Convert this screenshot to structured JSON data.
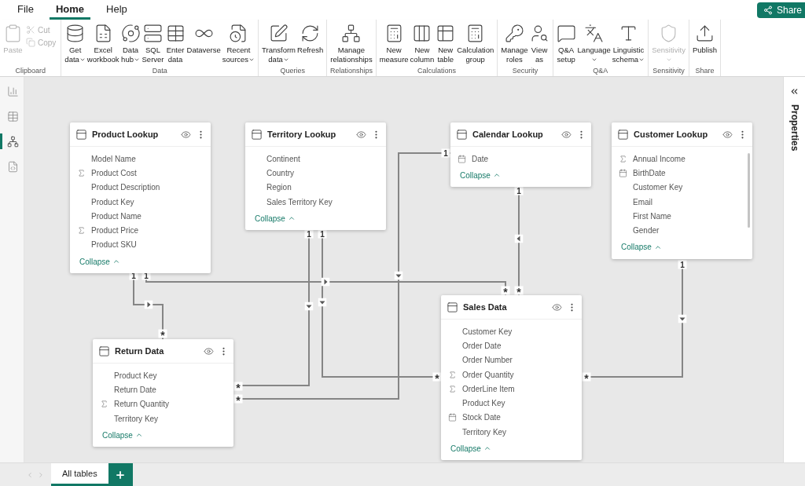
{
  "menu": {
    "tabs": [
      {
        "label": "File",
        "selected": false
      },
      {
        "label": "Home",
        "selected": true
      },
      {
        "label": "Help",
        "selected": false
      }
    ]
  },
  "share_button": {
    "label": "Share"
  },
  "ribbon": {
    "groups": [
      {
        "label": "Clipboard",
        "buttons": [
          {
            "lines": [
              "Paste"
            ],
            "kind": "large",
            "disabled": true,
            "dropdown": false
          },
          {
            "lines": [
              "Cut"
            ],
            "kind": "small",
            "disabled": true,
            "dropdown": false
          },
          {
            "lines": [
              "Copy"
            ],
            "kind": "small",
            "disabled": true,
            "dropdown": false
          }
        ]
      },
      {
        "label": "Data",
        "buttons": [
          {
            "lines": [
              "Get",
              "data"
            ],
            "kind": "large",
            "disabled": false,
            "dropdown": true
          },
          {
            "lines": [
              "Excel",
              "workbook"
            ],
            "kind": "large",
            "disabled": false,
            "dropdown": false
          },
          {
            "lines": [
              "Data",
              "hub"
            ],
            "kind": "large",
            "disabled": false,
            "dropdown": true
          },
          {
            "lines": [
              "SQL",
              "Server"
            ],
            "kind": "large",
            "disabled": false,
            "dropdown": false
          },
          {
            "lines": [
              "Enter",
              "data"
            ],
            "kind": "large",
            "disabled": false,
            "dropdown": false
          },
          {
            "lines": [
              "Dataverse"
            ],
            "kind": "large",
            "disabled": false,
            "dropdown": false
          },
          {
            "lines": [
              "Recent",
              "sources"
            ],
            "kind": "large",
            "disabled": false,
            "dropdown": true
          }
        ]
      },
      {
        "label": "Queries",
        "buttons": [
          {
            "lines": [
              "Transform",
              "data"
            ],
            "kind": "large",
            "disabled": false,
            "dropdown": true
          },
          {
            "lines": [
              "Refresh"
            ],
            "kind": "large",
            "disabled": false,
            "dropdown": false
          }
        ]
      },
      {
        "label": "Relationships",
        "buttons": [
          {
            "lines": [
              "Manage",
              "relationships"
            ],
            "kind": "large",
            "disabled": false,
            "dropdown": false
          }
        ]
      },
      {
        "label": "Calculations",
        "buttons": [
          {
            "lines": [
              "New",
              "measure"
            ],
            "kind": "large",
            "disabled": false,
            "dropdown": false
          },
          {
            "lines": [
              "New",
              "column"
            ],
            "kind": "large",
            "disabled": false,
            "dropdown": false
          },
          {
            "lines": [
              "New",
              "table"
            ],
            "kind": "large",
            "disabled": false,
            "dropdown": false
          },
          {
            "lines": [
              "Calculation",
              "group"
            ],
            "kind": "large",
            "disabled": false,
            "dropdown": false
          }
        ]
      },
      {
        "label": "Security",
        "buttons": [
          {
            "lines": [
              "Manage",
              "roles"
            ],
            "kind": "large",
            "disabled": false,
            "dropdown": false
          },
          {
            "lines": [
              "View",
              "as"
            ],
            "kind": "large",
            "disabled": false,
            "dropdown": false
          }
        ]
      },
      {
        "label": "Q&A",
        "buttons": [
          {
            "lines": [
              "Q&A",
              "setup"
            ],
            "kind": "large",
            "disabled": false,
            "dropdown": false
          },
          {
            "lines": [
              "Language"
            ],
            "kind": "large",
            "disabled": false,
            "dropdown": true
          },
          {
            "lines": [
              "Linguistic",
              "schema"
            ],
            "kind": "large",
            "disabled": false,
            "dropdown": true
          }
        ]
      },
      {
        "label": "Sensitivity",
        "buttons": [
          {
            "lines": [
              "Sensitivity"
            ],
            "kind": "large",
            "disabled": true,
            "dropdown": true
          }
        ]
      },
      {
        "label": "Share",
        "buttons": [
          {
            "lines": [
              "Publish"
            ],
            "kind": "large",
            "disabled": false,
            "dropdown": false
          }
        ]
      }
    ]
  },
  "view_rail": [
    {
      "selected": false
    },
    {
      "selected": false
    },
    {
      "selected": true
    },
    {
      "selected": false
    }
  ],
  "tables": [
    {
      "name": "Product Lookup",
      "scrollable": false,
      "collapse": "Collapse",
      "columns": [
        {
          "name": "Model Name",
          "kind": "text"
        },
        {
          "name": "Product Cost",
          "kind": "sum"
        },
        {
          "name": "Product Description",
          "kind": "text"
        },
        {
          "name": "Product Key",
          "kind": "text"
        },
        {
          "name": "Product Name",
          "kind": "text"
        },
        {
          "name": "Product Price",
          "kind": "sum"
        },
        {
          "name": "Product SKU",
          "kind": "text"
        }
      ]
    },
    {
      "name": "Territory Lookup",
      "scrollable": false,
      "collapse": "Collapse",
      "columns": [
        {
          "name": "Continent",
          "kind": "text"
        },
        {
          "name": "Country",
          "kind": "text"
        },
        {
          "name": "Region",
          "kind": "text"
        },
        {
          "name": "Sales Territory Key",
          "kind": "text"
        }
      ]
    },
    {
      "name": "Calendar Lookup",
      "scrollable": false,
      "collapse": "Collapse",
      "columns": [
        {
          "name": "Date",
          "kind": "date"
        }
      ]
    },
    {
      "name": "Customer Lookup",
      "scrollable": true,
      "collapse": "Collapse",
      "columns": [
        {
          "name": "Annual Income",
          "kind": "sum"
        },
        {
          "name": "BirthDate",
          "kind": "date"
        },
        {
          "name": "Customer Key",
          "kind": "text"
        },
        {
          "name": "Email",
          "kind": "text"
        },
        {
          "name": "First Name",
          "kind": "text"
        },
        {
          "name": "Gender",
          "kind": "text"
        }
      ]
    },
    {
      "name": "Return Data",
      "scrollable": false,
      "collapse": "Collapse",
      "columns": [
        {
          "name": "Product Key",
          "kind": "text"
        },
        {
          "name": "Return Date",
          "kind": "text"
        },
        {
          "name": "Return Quantity",
          "kind": "sum"
        },
        {
          "name": "Territory Key",
          "kind": "text"
        }
      ]
    },
    {
      "name": "Sales Data",
      "scrollable": false,
      "collapse": "Collapse",
      "columns": [
        {
          "name": "Customer Key",
          "kind": "text"
        },
        {
          "name": "Order Date",
          "kind": "text"
        },
        {
          "name": "Order Number",
          "kind": "text"
        },
        {
          "name": "Order Quantity",
          "kind": "sum"
        },
        {
          "name": "OrderLine Item",
          "kind": "sum"
        },
        {
          "name": "Product Key",
          "kind": "text"
        },
        {
          "name": "Stock Date",
          "kind": "date"
        },
        {
          "name": "Territory Key",
          "kind": "text"
        }
      ]
    }
  ],
  "relationships": [
    {
      "from": "1",
      "to": "*",
      "kind": "right"
    },
    {
      "from": "1",
      "to": "*",
      "kind": "right"
    },
    {
      "from": "1",
      "to": "*",
      "kind": "down"
    },
    {
      "from": "1",
      "to": "*",
      "kind": "down"
    },
    {
      "from": "1",
      "to": "*",
      "kind": "left"
    },
    {
      "from": "1",
      "to": "*",
      "kind": "down"
    },
    {
      "from": "1",
      "to": "*",
      "kind": "down"
    }
  ],
  "properties_pane": {
    "title": "Properties"
  },
  "page_tabs": [
    {
      "label": "All tables",
      "selected": true
    }
  ]
}
